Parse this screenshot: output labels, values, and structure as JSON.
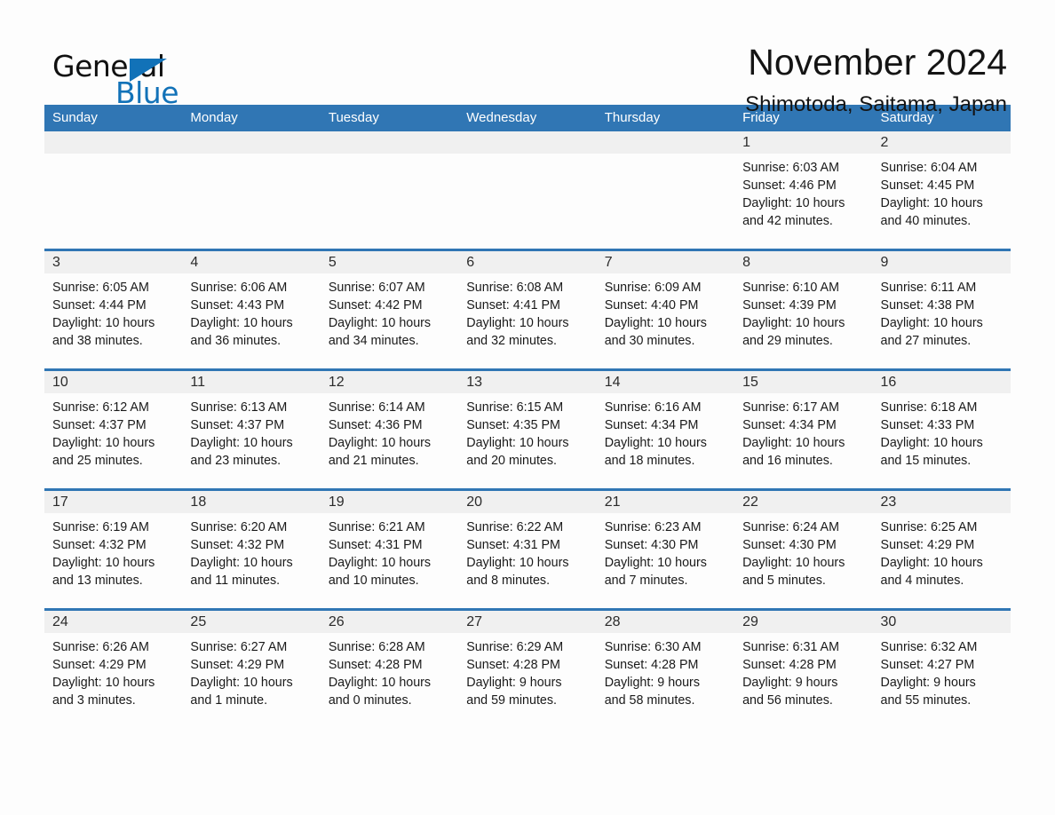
{
  "logo": {
    "word_one": "General",
    "word_two": "Blue",
    "triangle_color": "#1272b8"
  },
  "header": {
    "title": "November 2024",
    "location": "Shimotoda, Saitama, Japan"
  },
  "theme": {
    "header_blue": "#3076b4",
    "day_band_gray": "#f0f0f0",
    "page_background": "#fdfdfd"
  },
  "weekdays": [
    "Sunday",
    "Monday",
    "Tuesday",
    "Wednesday",
    "Thursday",
    "Friday",
    "Saturday"
  ],
  "weeks": [
    [
      {
        "day": "",
        "sunrise": "",
        "sunset": "",
        "daylight_line1": "",
        "daylight_line2": ""
      },
      {
        "day": "",
        "sunrise": "",
        "sunset": "",
        "daylight_line1": "",
        "daylight_line2": ""
      },
      {
        "day": "",
        "sunrise": "",
        "sunset": "",
        "daylight_line1": "",
        "daylight_line2": ""
      },
      {
        "day": "",
        "sunrise": "",
        "sunset": "",
        "daylight_line1": "",
        "daylight_line2": ""
      },
      {
        "day": "",
        "sunrise": "",
        "sunset": "",
        "daylight_line1": "",
        "daylight_line2": ""
      },
      {
        "day": "1",
        "sunrise": "Sunrise: 6:03 AM",
        "sunset": "Sunset: 4:46 PM",
        "daylight_line1": "Daylight: 10 hours",
        "daylight_line2": "and 42 minutes."
      },
      {
        "day": "2",
        "sunrise": "Sunrise: 6:04 AM",
        "sunset": "Sunset: 4:45 PM",
        "daylight_line1": "Daylight: 10 hours",
        "daylight_line2": "and 40 minutes."
      }
    ],
    [
      {
        "day": "3",
        "sunrise": "Sunrise: 6:05 AM",
        "sunset": "Sunset: 4:44 PM",
        "daylight_line1": "Daylight: 10 hours",
        "daylight_line2": "and 38 minutes."
      },
      {
        "day": "4",
        "sunrise": "Sunrise: 6:06 AM",
        "sunset": "Sunset: 4:43 PM",
        "daylight_line1": "Daylight: 10 hours",
        "daylight_line2": "and 36 minutes."
      },
      {
        "day": "5",
        "sunrise": "Sunrise: 6:07 AM",
        "sunset": "Sunset: 4:42 PM",
        "daylight_line1": "Daylight: 10 hours",
        "daylight_line2": "and 34 minutes."
      },
      {
        "day": "6",
        "sunrise": "Sunrise: 6:08 AM",
        "sunset": "Sunset: 4:41 PM",
        "daylight_line1": "Daylight: 10 hours",
        "daylight_line2": "and 32 minutes."
      },
      {
        "day": "7",
        "sunrise": "Sunrise: 6:09 AM",
        "sunset": "Sunset: 4:40 PM",
        "daylight_line1": "Daylight: 10 hours",
        "daylight_line2": "and 30 minutes."
      },
      {
        "day": "8",
        "sunrise": "Sunrise: 6:10 AM",
        "sunset": "Sunset: 4:39 PM",
        "daylight_line1": "Daylight: 10 hours",
        "daylight_line2": "and 29 minutes."
      },
      {
        "day": "9",
        "sunrise": "Sunrise: 6:11 AM",
        "sunset": "Sunset: 4:38 PM",
        "daylight_line1": "Daylight: 10 hours",
        "daylight_line2": "and 27 minutes."
      }
    ],
    [
      {
        "day": "10",
        "sunrise": "Sunrise: 6:12 AM",
        "sunset": "Sunset: 4:37 PM",
        "daylight_line1": "Daylight: 10 hours",
        "daylight_line2": "and 25 minutes."
      },
      {
        "day": "11",
        "sunrise": "Sunrise: 6:13 AM",
        "sunset": "Sunset: 4:37 PM",
        "daylight_line1": "Daylight: 10 hours",
        "daylight_line2": "and 23 minutes."
      },
      {
        "day": "12",
        "sunrise": "Sunrise: 6:14 AM",
        "sunset": "Sunset: 4:36 PM",
        "daylight_line1": "Daylight: 10 hours",
        "daylight_line2": "and 21 minutes."
      },
      {
        "day": "13",
        "sunrise": "Sunrise: 6:15 AM",
        "sunset": "Sunset: 4:35 PM",
        "daylight_line1": "Daylight: 10 hours",
        "daylight_line2": "and 20 minutes."
      },
      {
        "day": "14",
        "sunrise": "Sunrise: 6:16 AM",
        "sunset": "Sunset: 4:34 PM",
        "daylight_line1": "Daylight: 10 hours",
        "daylight_line2": "and 18 minutes."
      },
      {
        "day": "15",
        "sunrise": "Sunrise: 6:17 AM",
        "sunset": "Sunset: 4:34 PM",
        "daylight_line1": "Daylight: 10 hours",
        "daylight_line2": "and 16 minutes."
      },
      {
        "day": "16",
        "sunrise": "Sunrise: 6:18 AM",
        "sunset": "Sunset: 4:33 PM",
        "daylight_line1": "Daylight: 10 hours",
        "daylight_line2": "and 15 minutes."
      }
    ],
    [
      {
        "day": "17",
        "sunrise": "Sunrise: 6:19 AM",
        "sunset": "Sunset: 4:32 PM",
        "daylight_line1": "Daylight: 10 hours",
        "daylight_line2": "and 13 minutes."
      },
      {
        "day": "18",
        "sunrise": "Sunrise: 6:20 AM",
        "sunset": "Sunset: 4:32 PM",
        "daylight_line1": "Daylight: 10 hours",
        "daylight_line2": "and 11 minutes."
      },
      {
        "day": "19",
        "sunrise": "Sunrise: 6:21 AM",
        "sunset": "Sunset: 4:31 PM",
        "daylight_line1": "Daylight: 10 hours",
        "daylight_line2": "and 10 minutes."
      },
      {
        "day": "20",
        "sunrise": "Sunrise: 6:22 AM",
        "sunset": "Sunset: 4:31 PM",
        "daylight_line1": "Daylight: 10 hours",
        "daylight_line2": "and 8 minutes."
      },
      {
        "day": "21",
        "sunrise": "Sunrise: 6:23 AM",
        "sunset": "Sunset: 4:30 PM",
        "daylight_line1": "Daylight: 10 hours",
        "daylight_line2": "and 7 minutes."
      },
      {
        "day": "22",
        "sunrise": "Sunrise: 6:24 AM",
        "sunset": "Sunset: 4:30 PM",
        "daylight_line1": "Daylight: 10 hours",
        "daylight_line2": "and 5 minutes."
      },
      {
        "day": "23",
        "sunrise": "Sunrise: 6:25 AM",
        "sunset": "Sunset: 4:29 PM",
        "daylight_line1": "Daylight: 10 hours",
        "daylight_line2": "and 4 minutes."
      }
    ],
    [
      {
        "day": "24",
        "sunrise": "Sunrise: 6:26 AM",
        "sunset": "Sunset: 4:29 PM",
        "daylight_line1": "Daylight: 10 hours",
        "daylight_line2": "and 3 minutes."
      },
      {
        "day": "25",
        "sunrise": "Sunrise: 6:27 AM",
        "sunset": "Sunset: 4:29 PM",
        "daylight_line1": "Daylight: 10 hours",
        "daylight_line2": "and 1 minute."
      },
      {
        "day": "26",
        "sunrise": "Sunrise: 6:28 AM",
        "sunset": "Sunset: 4:28 PM",
        "daylight_line1": "Daylight: 10 hours",
        "daylight_line2": "and 0 minutes."
      },
      {
        "day": "27",
        "sunrise": "Sunrise: 6:29 AM",
        "sunset": "Sunset: 4:28 PM",
        "daylight_line1": "Daylight: 9 hours",
        "daylight_line2": "and 59 minutes."
      },
      {
        "day": "28",
        "sunrise": "Sunrise: 6:30 AM",
        "sunset": "Sunset: 4:28 PM",
        "daylight_line1": "Daylight: 9 hours",
        "daylight_line2": "and 58 minutes."
      },
      {
        "day": "29",
        "sunrise": "Sunrise: 6:31 AM",
        "sunset": "Sunset: 4:28 PM",
        "daylight_line1": "Daylight: 9 hours",
        "daylight_line2": "and 56 minutes."
      },
      {
        "day": "30",
        "sunrise": "Sunrise: 6:32 AM",
        "sunset": "Sunset: 4:27 PM",
        "daylight_line1": "Daylight: 9 hours",
        "daylight_line2": "and 55 minutes."
      }
    ]
  ]
}
